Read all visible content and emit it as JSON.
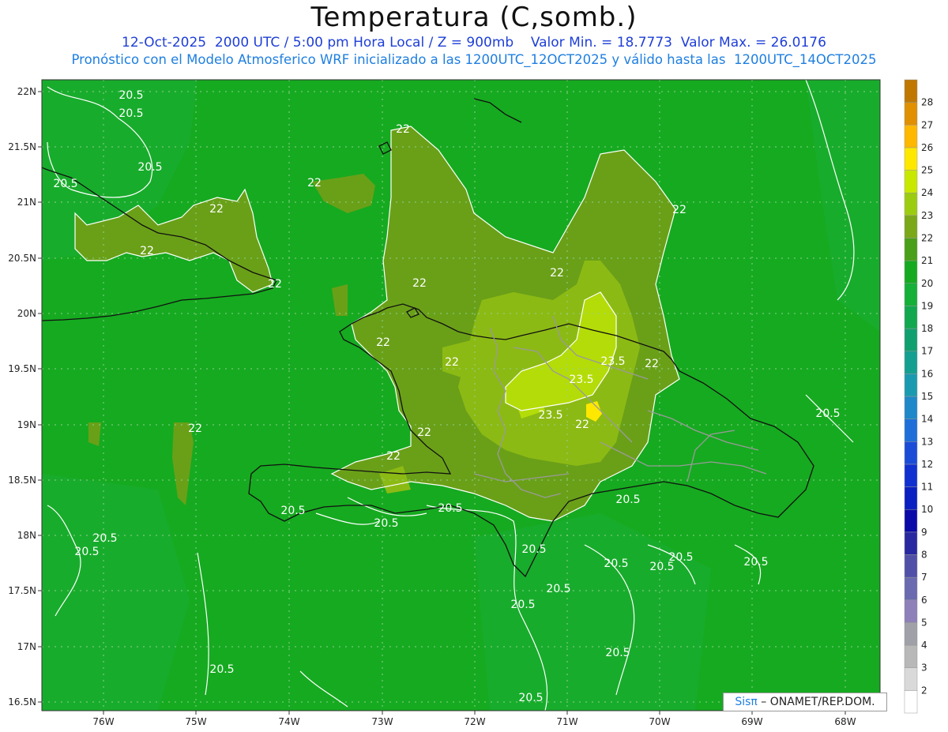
{
  "title": "Temperatura (C,somb.)",
  "subtitle_line1": "12-Oct-2025  2000 UTC / 5:00 pm Hora Local / Z = 900mb    Valor Min. = 18.7773  Valor Max. = 26.0176",
  "subtitle_line2": "Pronóstico con el Modelo Atmosferico WRF inicializado a las 1200UTC_12OCT2025 y válido hasta las  1200UTC_14OCT2025",
  "credit": {
    "brand": "Sisπ",
    "text": " – ONAMET/REP.DOM."
  },
  "lat_labels": [
    "22N",
    "21.5N",
    "21N",
    "20.5N",
    "20N",
    "19.5N",
    "19N",
    "18.5N",
    "18N",
    "17.5N",
    "17N",
    "16.5N"
  ],
  "lon_labels": [
    "76W",
    "75W",
    "74W",
    "73W",
    "72W",
    "71W",
    "70W",
    "69W",
    "68W"
  ],
  "colorbar": {
    "levels": [
      "2",
      "3",
      "4",
      "5",
      "6",
      "7",
      "8",
      "9",
      "10",
      "11",
      "12",
      "13",
      "14",
      "15",
      "16",
      "17",
      "18",
      "19",
      "20",
      "21",
      "22",
      "23",
      "24",
      "25",
      "26",
      "27",
      "28"
    ],
    "colors": [
      "#ffffff",
      "#d9d9d9",
      "#b8b8b8",
      "#a0a0a8",
      "#8e80b8",
      "#6a6ab0",
      "#5050a8",
      "#2828a0",
      "#0a0aa8",
      "#0a20c0",
      "#1030d0",
      "#1a4cd8",
      "#1e70d8",
      "#1e88c8",
      "#1a9ab0",
      "#14a090",
      "#10a070",
      "#12a850",
      "#14b038",
      "#16aa20",
      "#4aa018",
      "#7aa818",
      "#9ccc10",
      "#c8e800",
      "#ffe800",
      "#ffb800",
      "#e09000",
      "#c07800"
    ]
  },
  "contour_labels": [
    {
      "text": "20.5"
    },
    {
      "text": "20.5"
    },
    {
      "text": "20.5"
    },
    {
      "text": "20.5"
    },
    {
      "text": "22"
    },
    {
      "text": "22"
    },
    {
      "text": "22"
    },
    {
      "text": "22"
    },
    {
      "text": "22"
    },
    {
      "text": "22"
    },
    {
      "text": "22"
    },
    {
      "text": "22"
    },
    {
      "text": "22"
    },
    {
      "text": "22"
    },
    {
      "text": "22"
    },
    {
      "text": "22"
    },
    {
      "text": "22"
    },
    {
      "text": "23.5"
    },
    {
      "text": "23.5"
    },
    {
      "text": "23.5"
    },
    {
      "text": "22"
    },
    {
      "text": "22"
    },
    {
      "text": "20.5"
    },
    {
      "text": "20.5"
    },
    {
      "text": "20.5"
    },
    {
      "text": "20.5"
    },
    {
      "text": "20.5"
    },
    {
      "text": "20.5"
    },
    {
      "text": "20.5"
    },
    {
      "text": "20.5"
    },
    {
      "text": "20.5"
    },
    {
      "text": "20.5"
    },
    {
      "text": "20.5"
    },
    {
      "text": "20.5"
    },
    {
      "text": "20.5"
    },
    {
      "text": "20.5"
    },
    {
      "text": "20.5"
    },
    {
      "text": "20.5"
    },
    {
      "text": "20.5"
    }
  ]
}
